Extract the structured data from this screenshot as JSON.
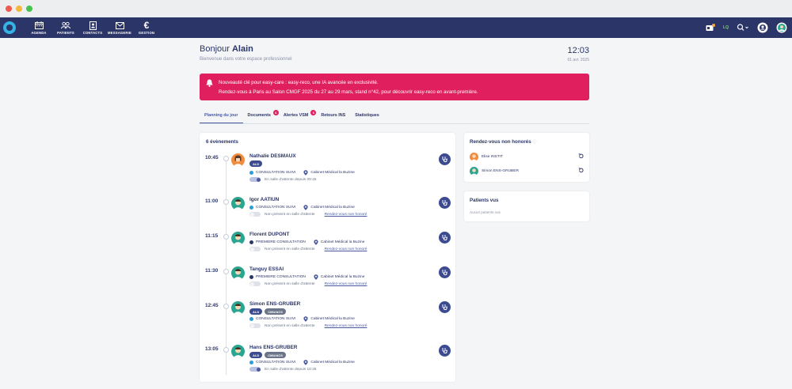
{
  "colors": {
    "nav_bg": "#2b3567",
    "alert_bg": "#e01f5e",
    "accent": "#4a5aa0"
  },
  "window_dots": [
    "#f05a4f",
    "#f4b73c",
    "#48c24f"
  ],
  "nav": {
    "items": [
      {
        "label": "AGENDA",
        "icon": "calendar-icon"
      },
      {
        "label": "PATIENTS",
        "icon": "users-icon"
      },
      {
        "label": "CONTACTS",
        "icon": "contact-book-icon"
      },
      {
        "label": "MESSAGERIE",
        "icon": "mail-icon"
      },
      {
        "label": "GESTION",
        "icon": "euro-icon"
      }
    ],
    "right_badge_text": "LQ"
  },
  "header": {
    "greeting_prefix": "Bonjour",
    "user": "Alain",
    "welcome": "Bienvenue dans votre espace professionnel",
    "time": "12:03",
    "date": "01 avr. 2025"
  },
  "alert": {
    "line1": "Nouveauté clé pour easy-care : easy-reco, une IA avancée en exclusivité.",
    "line2": "Rendez-vous à Paris au Salon CMGF 2025 du 27 au 29 mars, stand n°42, pour découvrir easy-reco en avant-première."
  },
  "tabs": [
    {
      "label": "Planning du jour",
      "badge": ""
    },
    {
      "label": "Documents",
      "badge": "6"
    },
    {
      "label": "Alertes VSM",
      "badge": "6"
    },
    {
      "label": "Retours INS",
      "badge": ""
    },
    {
      "label": "Statistiques",
      "badge": ""
    }
  ],
  "events_title": "6 évènements",
  "appointments": [
    {
      "time": "10:45",
      "name": "Nathalie DESMAUX",
      "tags": [
        "ALD"
      ],
      "type": "CONSULTATION SUIVI",
      "location": "Cabinet Médical la Buzine",
      "status": "En salle d'attente depuis 09:45",
      "link": "",
      "waiting": true
    },
    {
      "time": "11:00",
      "name": "Igor AATIUN",
      "tags": [],
      "type": "CONSULTATION SUIVI",
      "location": "Cabinet Médical la Buzine",
      "status": "Non présent en salle d'attente",
      "link": "Rendez-vous non honoré",
      "waiting": false
    },
    {
      "time": "11:15",
      "name": "Florent DUPONT",
      "tags": [],
      "type": "PREMIERE CONSULTATION",
      "location": "Cabinet Médical la Buzine",
      "status": "Non présent en salle d'attente",
      "link": "Rendez-vous non honoré",
      "waiting": false
    },
    {
      "time": "11:30",
      "name": "Tanguy ESSAI",
      "tags": [],
      "type": "PREMIERE CONSULTATION",
      "location": "Cabinet Médical la Buzine",
      "status": "Non présent en salle d'attente",
      "link": "Rendez-vous non honoré",
      "waiting": false
    },
    {
      "time": "12:45",
      "name": "Simon ENS-GRUBER",
      "tags": [
        "ALD",
        "CMU/ACS"
      ],
      "type": "CONSULTATION SUIVI",
      "location": "Cabinet Médical la Buzine",
      "status": "Non présent en salle d'attente",
      "link": "Rendez-vous non honoré",
      "waiting": false
    },
    {
      "time": "13:05",
      "name": "Hans ENS-GRUBER",
      "tags": [
        "ALD",
        "CMU/ACS"
      ],
      "type": "CONSULTATION SUIVI",
      "location": "Cabinet Médical la Buzine",
      "status": "En salle d'attente depuis 10:35",
      "link": "",
      "waiting": true
    }
  ],
  "missed": {
    "title": "Rendez-vous non honorés",
    "items": [
      "Elise INSTIT",
      "Simon ENS-GRUBER"
    ]
  },
  "seen": {
    "title": "Patients vus",
    "empty": "Aucun patients vus"
  }
}
